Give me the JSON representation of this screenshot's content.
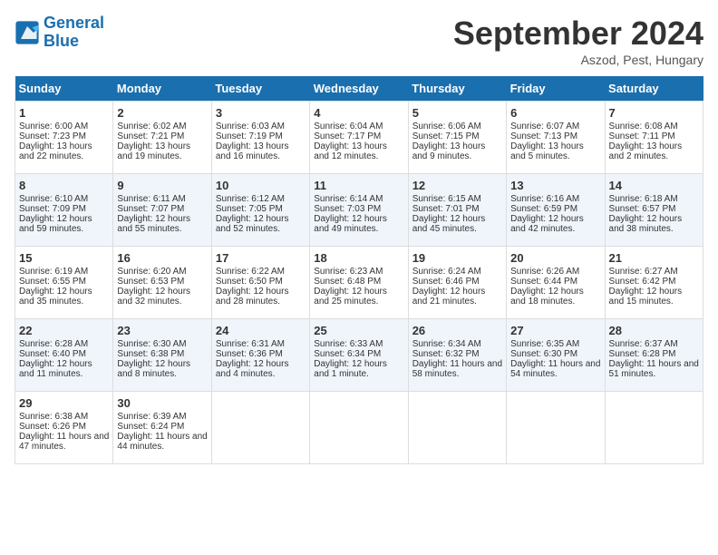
{
  "header": {
    "logo_line1": "General",
    "logo_line2": "Blue",
    "month_title": "September 2024",
    "location": "Aszod, Pest, Hungary"
  },
  "days_of_week": [
    "Sunday",
    "Monday",
    "Tuesday",
    "Wednesday",
    "Thursday",
    "Friday",
    "Saturday"
  ],
  "weeks": [
    [
      {
        "day": "1",
        "sunrise": "6:00 AM",
        "sunset": "7:23 PM",
        "daylight": "13 hours and 22 minutes."
      },
      {
        "day": "2",
        "sunrise": "6:02 AM",
        "sunset": "7:21 PM",
        "daylight": "13 hours and 19 minutes."
      },
      {
        "day": "3",
        "sunrise": "6:03 AM",
        "sunset": "7:19 PM",
        "daylight": "13 hours and 16 minutes."
      },
      {
        "day": "4",
        "sunrise": "6:04 AM",
        "sunset": "7:17 PM",
        "daylight": "13 hours and 12 minutes."
      },
      {
        "day": "5",
        "sunrise": "6:06 AM",
        "sunset": "7:15 PM",
        "daylight": "13 hours and 9 minutes."
      },
      {
        "day": "6",
        "sunrise": "6:07 AM",
        "sunset": "7:13 PM",
        "daylight": "13 hours and 5 minutes."
      },
      {
        "day": "7",
        "sunrise": "6:08 AM",
        "sunset": "7:11 PM",
        "daylight": "13 hours and 2 minutes."
      }
    ],
    [
      {
        "day": "8",
        "sunrise": "6:10 AM",
        "sunset": "7:09 PM",
        "daylight": "12 hours and 59 minutes."
      },
      {
        "day": "9",
        "sunrise": "6:11 AM",
        "sunset": "7:07 PM",
        "daylight": "12 hours and 55 minutes."
      },
      {
        "day": "10",
        "sunrise": "6:12 AM",
        "sunset": "7:05 PM",
        "daylight": "12 hours and 52 minutes."
      },
      {
        "day": "11",
        "sunrise": "6:14 AM",
        "sunset": "7:03 PM",
        "daylight": "12 hours and 49 minutes."
      },
      {
        "day": "12",
        "sunrise": "6:15 AM",
        "sunset": "7:01 PM",
        "daylight": "12 hours and 45 minutes."
      },
      {
        "day": "13",
        "sunrise": "6:16 AM",
        "sunset": "6:59 PM",
        "daylight": "12 hours and 42 minutes."
      },
      {
        "day": "14",
        "sunrise": "6:18 AM",
        "sunset": "6:57 PM",
        "daylight": "12 hours and 38 minutes."
      }
    ],
    [
      {
        "day": "15",
        "sunrise": "6:19 AM",
        "sunset": "6:55 PM",
        "daylight": "12 hours and 35 minutes."
      },
      {
        "day": "16",
        "sunrise": "6:20 AM",
        "sunset": "6:53 PM",
        "daylight": "12 hours and 32 minutes."
      },
      {
        "day": "17",
        "sunrise": "6:22 AM",
        "sunset": "6:50 PM",
        "daylight": "12 hours and 28 minutes."
      },
      {
        "day": "18",
        "sunrise": "6:23 AM",
        "sunset": "6:48 PM",
        "daylight": "12 hours and 25 minutes."
      },
      {
        "day": "19",
        "sunrise": "6:24 AM",
        "sunset": "6:46 PM",
        "daylight": "12 hours and 21 minutes."
      },
      {
        "day": "20",
        "sunrise": "6:26 AM",
        "sunset": "6:44 PM",
        "daylight": "12 hours and 18 minutes."
      },
      {
        "day": "21",
        "sunrise": "6:27 AM",
        "sunset": "6:42 PM",
        "daylight": "12 hours and 15 minutes."
      }
    ],
    [
      {
        "day": "22",
        "sunrise": "6:28 AM",
        "sunset": "6:40 PM",
        "daylight": "12 hours and 11 minutes."
      },
      {
        "day": "23",
        "sunrise": "6:30 AM",
        "sunset": "6:38 PM",
        "daylight": "12 hours and 8 minutes."
      },
      {
        "day": "24",
        "sunrise": "6:31 AM",
        "sunset": "6:36 PM",
        "daylight": "12 hours and 4 minutes."
      },
      {
        "day": "25",
        "sunrise": "6:33 AM",
        "sunset": "6:34 PM",
        "daylight": "12 hours and 1 minute."
      },
      {
        "day": "26",
        "sunrise": "6:34 AM",
        "sunset": "6:32 PM",
        "daylight": "11 hours and 58 minutes."
      },
      {
        "day": "27",
        "sunrise": "6:35 AM",
        "sunset": "6:30 PM",
        "daylight": "11 hours and 54 minutes."
      },
      {
        "day": "28",
        "sunrise": "6:37 AM",
        "sunset": "6:28 PM",
        "daylight": "11 hours and 51 minutes."
      }
    ],
    [
      {
        "day": "29",
        "sunrise": "6:38 AM",
        "sunset": "6:26 PM",
        "daylight": "11 hours and 47 minutes."
      },
      {
        "day": "30",
        "sunrise": "6:39 AM",
        "sunset": "6:24 PM",
        "daylight": "11 hours and 44 minutes."
      },
      null,
      null,
      null,
      null,
      null
    ]
  ]
}
